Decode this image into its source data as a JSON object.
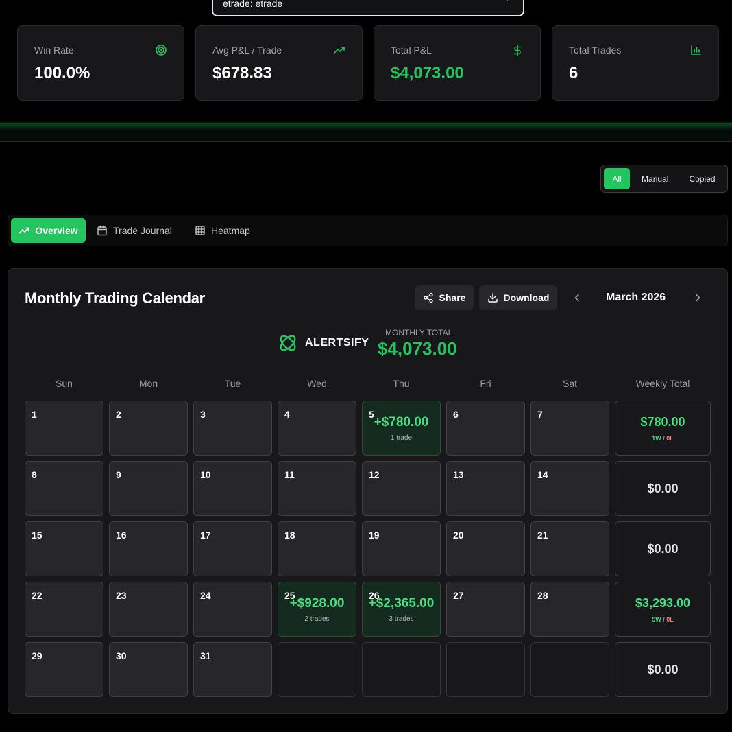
{
  "account": {
    "selected": "etrade: etrade"
  },
  "stats": [
    {
      "label": "Win Rate",
      "value": "100.0%",
      "icon": "target-icon"
    },
    {
      "label": "Avg P&L / Trade",
      "value": "$678.83",
      "icon": "trending-up-icon"
    },
    {
      "label": "Total P&L",
      "value": "$4,073.00",
      "icon": "dollar-icon"
    },
    {
      "label": "Total Trades",
      "value": "6",
      "icon": "bar-chart-icon"
    }
  ],
  "filters": {
    "all": "All",
    "manual": "Manual",
    "copied": "Copied",
    "active": "All"
  },
  "tabs": {
    "overview": "Overview",
    "journal": "Trade Journal",
    "heatmap": "Heatmap",
    "active": "Overview"
  },
  "calendar": {
    "title": "Monthly Trading Calendar",
    "share_label": "Share",
    "download_label": "Download",
    "month": "March 2026",
    "brand": "ALERTSIFY",
    "monthly_total_label": "MONTHLY TOTAL",
    "monthly_total": "$4,073.00",
    "weekdays": [
      "Sun",
      "Mon",
      "Tue",
      "Wed",
      "Thu",
      "Fri",
      "Sat"
    ],
    "weekly_header": "Weekly Total",
    "weeks": [
      {
        "days": [
          {
            "num": "1"
          },
          {
            "num": "2"
          },
          {
            "num": "3"
          },
          {
            "num": "4"
          },
          {
            "num": "5",
            "pnl": "+$780.00",
            "trades": "1 trade"
          },
          {
            "num": "6"
          },
          {
            "num": "7"
          }
        ],
        "total": "$780.00",
        "wins": "1W",
        "losses": "0L"
      },
      {
        "days": [
          {
            "num": "8"
          },
          {
            "num": "9"
          },
          {
            "num": "10"
          },
          {
            "num": "11"
          },
          {
            "num": "12"
          },
          {
            "num": "13"
          },
          {
            "num": "14"
          }
        ],
        "total": "$0.00"
      },
      {
        "days": [
          {
            "num": "15"
          },
          {
            "num": "16"
          },
          {
            "num": "17"
          },
          {
            "num": "18"
          },
          {
            "num": "19"
          },
          {
            "num": "20"
          },
          {
            "num": "21"
          }
        ],
        "total": "$0.00"
      },
      {
        "days": [
          {
            "num": "22"
          },
          {
            "num": "23"
          },
          {
            "num": "24"
          },
          {
            "num": "25",
            "pnl": "+$928.00",
            "trades": "2 trades"
          },
          {
            "num": "26",
            "pnl": "+$2,365.00",
            "trades": "3 trades"
          },
          {
            "num": "27"
          },
          {
            "num": "28"
          }
        ],
        "total": "$3,293.00",
        "wins": "5W",
        "losses": "0L"
      },
      {
        "days": [
          {
            "num": "29"
          },
          {
            "num": "30"
          },
          {
            "num": "31"
          },
          {
            "num": ""
          },
          {
            "num": ""
          },
          {
            "num": ""
          },
          {
            "num": ""
          }
        ],
        "total": "$0.00"
      }
    ]
  },
  "colors": {
    "accent": "#22c55e",
    "win_text": "#4ade80",
    "loss_text": "#f87171",
    "panel": "#18181b",
    "cell": "#27272a"
  }
}
